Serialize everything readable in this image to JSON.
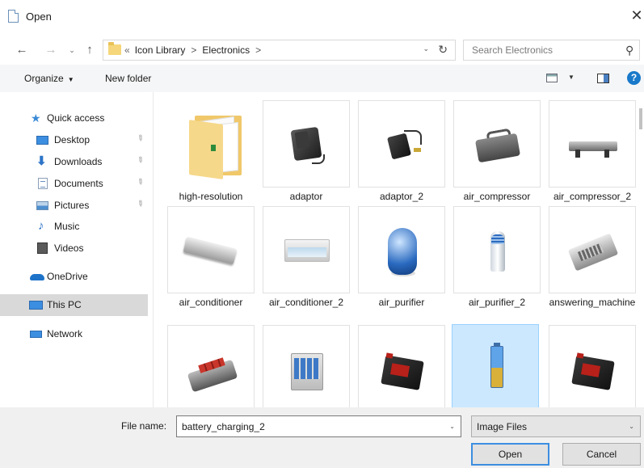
{
  "window": {
    "title": "Open",
    "close_glyph": "✕"
  },
  "navigation": {
    "back_glyph": "←",
    "forward_glyph": "→",
    "recent_glyph": "⌄",
    "up_glyph": "↑"
  },
  "address": {
    "overflow": "«",
    "crumbs": [
      "Icon Library",
      "Electronics"
    ],
    "separator": ">",
    "refresh_glyph": "↻",
    "dropdown_glyph": "⌄"
  },
  "search": {
    "placeholder": "Search Electronics",
    "icon_glyph": "⚲"
  },
  "toolbar": {
    "organize_label": "Organize",
    "new_folder_label": "New folder",
    "help_glyph": "?"
  },
  "sidebar": {
    "items": [
      {
        "label": "Quick access",
        "icon": "star-icon",
        "pinned": false
      },
      {
        "label": "Desktop",
        "icon": "desktop-icon",
        "pinned": true
      },
      {
        "label": "Downloads",
        "icon": "download-arrow-icon",
        "pinned": true
      },
      {
        "label": "Documents",
        "icon": "documents-icon",
        "pinned": true
      },
      {
        "label": "Pictures",
        "icon": "pictures-icon",
        "pinned": true
      },
      {
        "label": "Music",
        "icon": "music-note-icon",
        "pinned": false
      },
      {
        "label": "Videos",
        "icon": "videos-icon",
        "pinned": false
      },
      {
        "label": "OneDrive",
        "icon": "cloud-icon",
        "pinned": false
      },
      {
        "label": "This PC",
        "icon": "computer-icon",
        "pinned": false,
        "selected": true
      },
      {
        "label": "Network",
        "icon": "network-icon",
        "pinned": false
      }
    ],
    "pin_glyph": "📌"
  },
  "files": [
    {
      "name": "high-resolution",
      "type": "folder"
    },
    {
      "name": "adaptor",
      "type": "image"
    },
    {
      "name": "adaptor_2",
      "type": "image"
    },
    {
      "name": "air_compressor",
      "type": "image"
    },
    {
      "name": "air_compressor_2",
      "type": "image"
    },
    {
      "name": "air_conditioner",
      "type": "image"
    },
    {
      "name": "air_conditioner_2",
      "type": "image"
    },
    {
      "name": "air_purifier",
      "type": "image"
    },
    {
      "name": "air_purifier_2",
      "type": "image"
    },
    {
      "name": "answering_machine",
      "type": "image"
    },
    {
      "name": "",
      "type": "image"
    },
    {
      "name": "",
      "type": "image"
    },
    {
      "name": "",
      "type": "image"
    },
    {
      "name": "",
      "type": "image",
      "selected": true
    },
    {
      "name": "",
      "type": "image"
    }
  ],
  "footer": {
    "file_name_label": "File name:",
    "file_name_value": "battery_charging_2",
    "file_type_value": "Image Files",
    "open_label": "Open",
    "cancel_label": "Cancel",
    "dropdown_glyph": "⌄"
  },
  "colors": {
    "accent": "#3c8ee0",
    "selection": "#cce8ff",
    "help": "#1979ca"
  }
}
